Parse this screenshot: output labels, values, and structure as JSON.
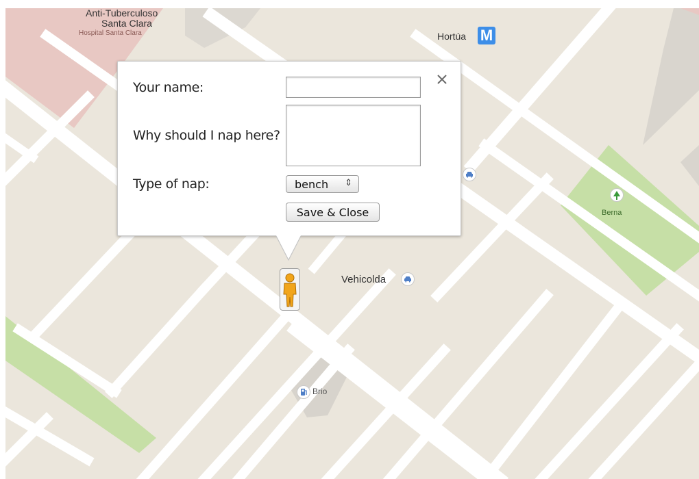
{
  "map": {
    "labels": {
      "hospital_line1": "Anti-Tuberculoso",
      "hospital_line2": "Santa Clara",
      "hospital_sub": "Hospital Santa Clara",
      "hortua": "Hortúa",
      "metro_letter": "M",
      "vehicolda": "Vehicolda",
      "berna": "Berna",
      "brio": "Brio"
    },
    "colors": {
      "land": "#ebe6dc",
      "road": "#ffffff",
      "park": "#c6dfa6",
      "hospital": "#e8c8c3",
      "block_gray": "#d9d5ce",
      "metro": "#3d8ee8"
    },
    "icons": [
      "metro-icon",
      "car-dealer-icon",
      "park-tree-icon",
      "gas-station-icon",
      "pegman-icon"
    ]
  },
  "form": {
    "name_label": "Your name:",
    "name_value": "",
    "why_label": "Why should I nap here?",
    "why_value": "",
    "type_label": "Type of nap:",
    "type_selected": "bench",
    "type_arrow": "⇕",
    "save_label": "Save & Close",
    "close_glyph": "×"
  }
}
